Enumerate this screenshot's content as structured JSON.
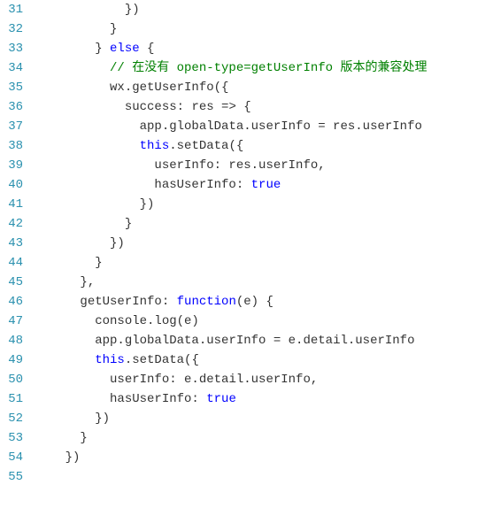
{
  "lines": [
    {
      "num": 31,
      "indent": "            ",
      "tokens": [
        {
          "t": "})",
          "c": "punct"
        }
      ]
    },
    {
      "num": 32,
      "indent": "          ",
      "tokens": [
        {
          "t": "}",
          "c": "punct"
        }
      ]
    },
    {
      "num": 33,
      "indent": "        ",
      "tokens": [
        {
          "t": "} ",
          "c": "punct"
        },
        {
          "t": "else",
          "c": "kw"
        },
        {
          "t": " {",
          "c": "punct"
        }
      ]
    },
    {
      "num": 34,
      "indent": "          ",
      "tokens": [
        {
          "t": "// 在没有 open-type=getUserInfo 版本的兼容处理",
          "c": "comment"
        }
      ]
    },
    {
      "num": 35,
      "indent": "          ",
      "tokens": [
        {
          "t": "wx.getUserInfo({",
          "c": "punct"
        }
      ]
    },
    {
      "num": 36,
      "indent": "            ",
      "tokens": [
        {
          "t": "success: res => {",
          "c": "punct"
        }
      ]
    },
    {
      "num": 37,
      "indent": "              ",
      "tokens": [
        {
          "t": "app.globalData.userInfo = res.userInfo",
          "c": "punct"
        }
      ]
    },
    {
      "num": 38,
      "indent": "              ",
      "tokens": [
        {
          "t": "this",
          "c": "this"
        },
        {
          "t": ".setData({",
          "c": "punct"
        }
      ]
    },
    {
      "num": 39,
      "indent": "                ",
      "tokens": [
        {
          "t": "userInfo: res.userInfo,",
          "c": "punct"
        }
      ]
    },
    {
      "num": 40,
      "indent": "                ",
      "tokens": [
        {
          "t": "hasUserInfo: ",
          "c": "punct"
        },
        {
          "t": "true",
          "c": "bool"
        }
      ]
    },
    {
      "num": 41,
      "indent": "              ",
      "tokens": [
        {
          "t": "})",
          "c": "punct"
        }
      ]
    },
    {
      "num": 42,
      "indent": "            ",
      "tokens": [
        {
          "t": "}",
          "c": "punct"
        }
      ]
    },
    {
      "num": 43,
      "indent": "          ",
      "tokens": [
        {
          "t": "})",
          "c": "punct"
        }
      ]
    },
    {
      "num": 44,
      "indent": "        ",
      "tokens": [
        {
          "t": "}",
          "c": "punct"
        }
      ]
    },
    {
      "num": 45,
      "indent": "      ",
      "tokens": [
        {
          "t": "},",
          "c": "punct"
        }
      ]
    },
    {
      "num": 46,
      "indent": "      ",
      "tokens": [
        {
          "t": "getUserInfo: ",
          "c": "punct"
        },
        {
          "t": "function",
          "c": "kw"
        },
        {
          "t": "(e) {",
          "c": "punct"
        }
      ]
    },
    {
      "num": 47,
      "indent": "        ",
      "tokens": [
        {
          "t": "console.log(e)",
          "c": "punct"
        }
      ]
    },
    {
      "num": 48,
      "indent": "        ",
      "tokens": [
        {
          "t": "app.globalData.userInfo = e.detail.userInfo",
          "c": "punct"
        }
      ]
    },
    {
      "num": 49,
      "indent": "        ",
      "tokens": [
        {
          "t": "this",
          "c": "this"
        },
        {
          "t": ".setData({",
          "c": "punct"
        }
      ]
    },
    {
      "num": 50,
      "indent": "          ",
      "tokens": [
        {
          "t": "userInfo: e.detail.userInfo,",
          "c": "punct"
        }
      ]
    },
    {
      "num": 51,
      "indent": "          ",
      "tokens": [
        {
          "t": "hasUserInfo: ",
          "c": "punct"
        },
        {
          "t": "true",
          "c": "bool"
        }
      ]
    },
    {
      "num": 52,
      "indent": "        ",
      "tokens": [
        {
          "t": "})",
          "c": "punct"
        }
      ]
    },
    {
      "num": 53,
      "indent": "      ",
      "tokens": [
        {
          "t": "}",
          "c": "punct"
        }
      ]
    },
    {
      "num": 54,
      "indent": "    ",
      "tokens": [
        {
          "t": "})",
          "c": "punct"
        }
      ]
    },
    {
      "num": 55,
      "indent": "",
      "tokens": []
    }
  ]
}
